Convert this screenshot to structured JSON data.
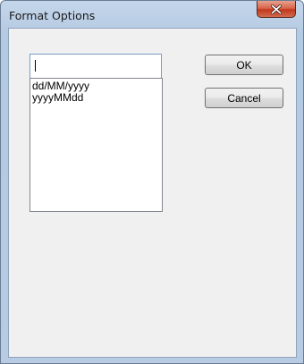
{
  "window": {
    "title": "Format Options"
  },
  "format_input": {
    "value": ""
  },
  "format_list": {
    "items": [
      "dd/MM/yyyy",
      "yyyyMMdd"
    ]
  },
  "buttons": {
    "ok_label": "OK",
    "cancel_label": "Cancel"
  },
  "colors": {
    "titlebar": "#b9cde5",
    "close_button": "#c7452a",
    "client_background": "#f0f0f0"
  },
  "icons": {
    "close": "close-icon"
  }
}
